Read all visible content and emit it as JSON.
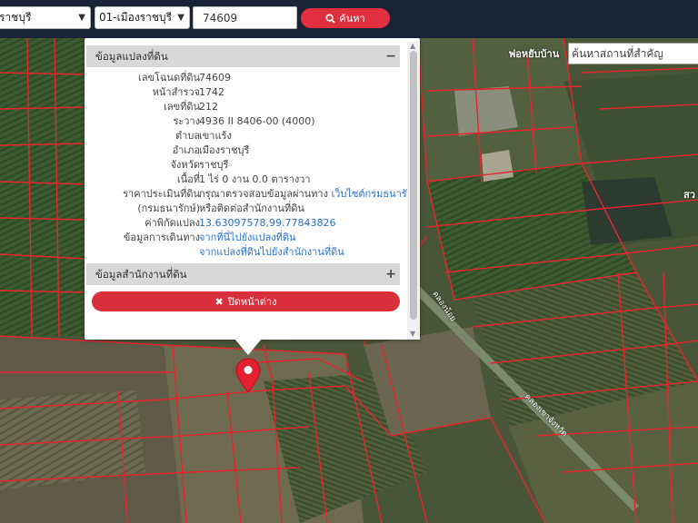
{
  "toolbar": {
    "province": "ราชบุรี",
    "district": "01-เมืองราชบุรี",
    "parcel_number": "74609",
    "search_label": "ค้นหา"
  },
  "place_search": {
    "placeholder": "ค้นหาสถานที่สำคัญ"
  },
  "popup": {
    "section1_title": "ข้อมูลแปลงที่ดิน",
    "section1_symbol": "−",
    "rows": [
      {
        "label": "เลขโฉนดที่ดิน",
        "value": "74609"
      },
      {
        "label": "หน้าสำรวจ",
        "value": "1742"
      },
      {
        "label": "เลขที่ดิน",
        "value": "212"
      },
      {
        "label": "ระวาง",
        "value": "4936 II 8406-00 (4000)"
      },
      {
        "label": "ตำบล",
        "value": "เขาแร้ง"
      },
      {
        "label": "อำเภอ",
        "value": "เมืองราชบุรี"
      },
      {
        "label": "จังหวัด",
        "value": "ราชบุรี"
      },
      {
        "label": "เนื้อที่",
        "value": "1 ไร่ 0 งาน 0.0 ตารางวา"
      },
      {
        "label": "ราคาประเมินที่ดิน",
        "value": "กรุณาตรวจสอบข้อมูลผ่านทาง",
        "link": "เว็บไซต์กรมธนารักษ์"
      },
      {
        "label": "(กรมธนารักษ์)",
        "value": "หรือติดต่อสำนักงานที่ดิน"
      },
      {
        "label": "ค่าพิกัดแปลง",
        "value": "13.63097578,99.77843826",
        "is_link": true
      },
      {
        "label": "ข้อมูลการเดินทาง",
        "value": "จากที่นี่ไปยังแปลงที่ดิน",
        "is_link": true
      },
      {
        "label": "",
        "value": "จากแปลงที่ดินไปยังสำนักงานที่ดิน",
        "is_link": true
      }
    ],
    "section2_title": "ข้อมูลสำนักงานที่ดิน",
    "section2_symbol": "+",
    "close_label": "ปิดหน้าต่าง"
  },
  "map_labels": {
    "top_label": "พ่อหยับบ้าน",
    "right_label": "สว",
    "road_label1": "คลองน้อย",
    "road_label2": "คลองเขาจังหวัด"
  },
  "colors": {
    "topbar": "#1a2238",
    "accent_red": "#e0303f",
    "parcel_line": "#e8232f",
    "link_blue": "#2a72c9"
  }
}
